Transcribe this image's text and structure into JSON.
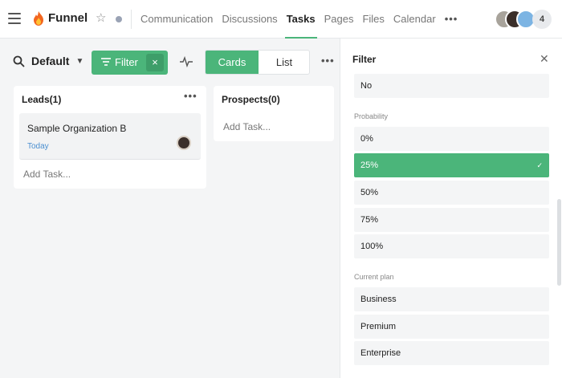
{
  "header": {
    "title": "Funnel",
    "nav": [
      "Communication",
      "Discussions",
      "Tasks",
      "Pages",
      "Files",
      "Calendar"
    ],
    "nav_active": "Tasks",
    "nav_more": "•••",
    "member_count": "4"
  },
  "toolbar": {
    "view": "Default",
    "filter_label": "Filter",
    "filter_clear": "×",
    "segments": [
      "Cards",
      "List"
    ],
    "more": "•••"
  },
  "board": {
    "columns": [
      {
        "title": "Leads(1)",
        "more": "•••",
        "cards": [
          {
            "title": "Sample Organization B",
            "date": "Today"
          }
        ],
        "add_task": "Add Task..."
      },
      {
        "title": "Prospects(0)",
        "cards": [],
        "add_task": "Add Task..."
      }
    ]
  },
  "filter_panel": {
    "title": "Filter",
    "close": "✕",
    "top_option": "No",
    "probability": {
      "label": "Probability",
      "options": [
        "0%",
        "25%",
        "50%",
        "75%",
        "100%"
      ],
      "selected": "25%"
    },
    "current_plan": {
      "label": "Current plan",
      "options": [
        "Business",
        "Premium",
        "Enterprise"
      ]
    }
  },
  "colors": {
    "accent": "#4bb57a",
    "link": "#4a8fd0"
  }
}
